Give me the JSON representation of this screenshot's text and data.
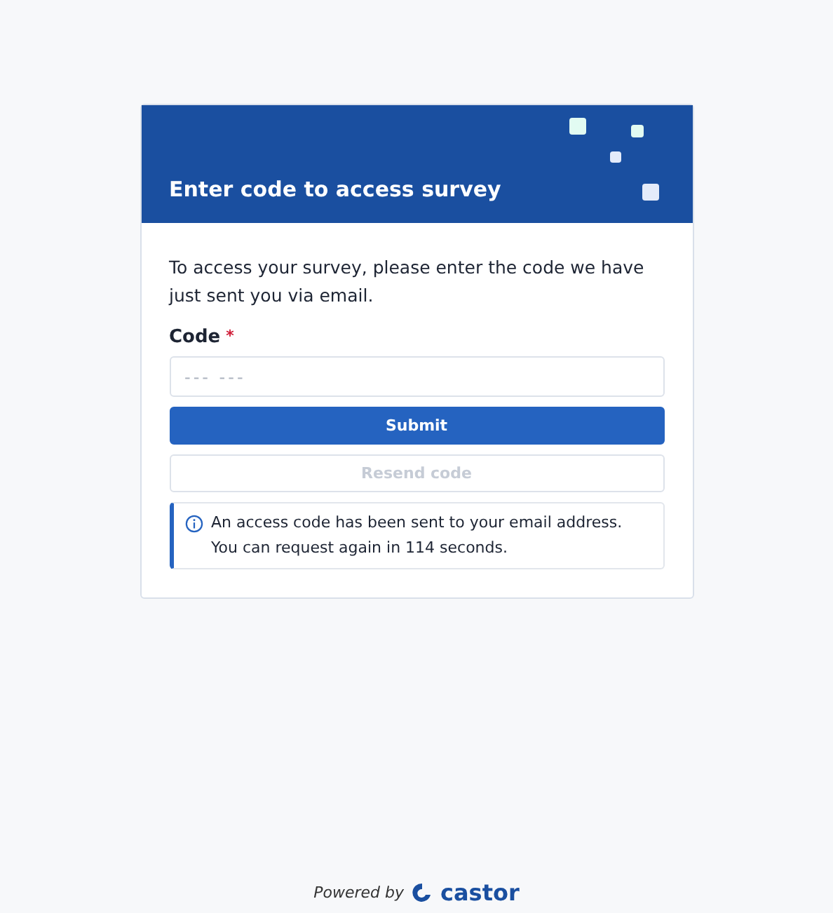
{
  "card": {
    "title": "Enter code to access survey",
    "intro": "To access your survey, please enter the code we have just sent you via email.",
    "field": {
      "label": "Code",
      "required_mark": "*",
      "placeholder": "--- ---"
    },
    "buttons": [
      {
        "label": "Submit",
        "kind": "primary",
        "disabled": false
      },
      {
        "label": "Resend code",
        "kind": "secondary",
        "disabled": true
      }
    ],
    "notice": "An access code has been sent to your email address. You can request again in 114 seconds."
  },
  "footer": {
    "powered_by": "Powered by",
    "brand": "castor"
  }
}
